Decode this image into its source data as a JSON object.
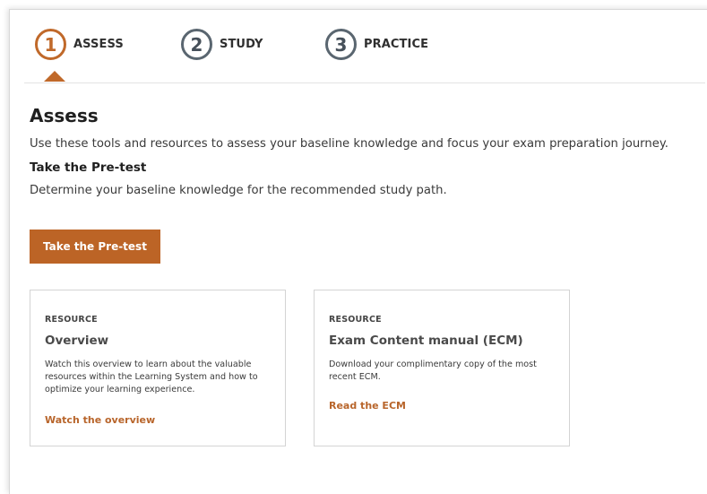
{
  "steps": [
    {
      "number": "1",
      "label": "ASSESS",
      "active": true
    },
    {
      "number": "2",
      "label": "STUDY",
      "active": false
    },
    {
      "number": "3",
      "label": "PRACTICE",
      "active": false
    }
  ],
  "section": {
    "title": "Assess",
    "intro": "Use these tools and resources to assess your baseline knowledge and focus your exam preparation journey.",
    "subtitle": "Take the Pre-test",
    "subtext": "Determine your baseline knowledge for the recommended study path.",
    "cta_label": "Take the Pre-test"
  },
  "cards": [
    {
      "kicker": "RESOURCE",
      "title": "Overview",
      "description": "Watch this overview to learn about the valuable resources within the Learning System and how to optimize your learning experience.",
      "link": "Watch the overview"
    },
    {
      "kicker": "RESOURCE",
      "title": "Exam Content manual (ECM)",
      "description": "Download your complimentary copy of the most recent ECM.",
      "link": "Read the ECM"
    }
  ],
  "colors": {
    "accent": "#bc6426",
    "inactive_step": "#5a6670",
    "card_border": "#d4d4d4"
  }
}
